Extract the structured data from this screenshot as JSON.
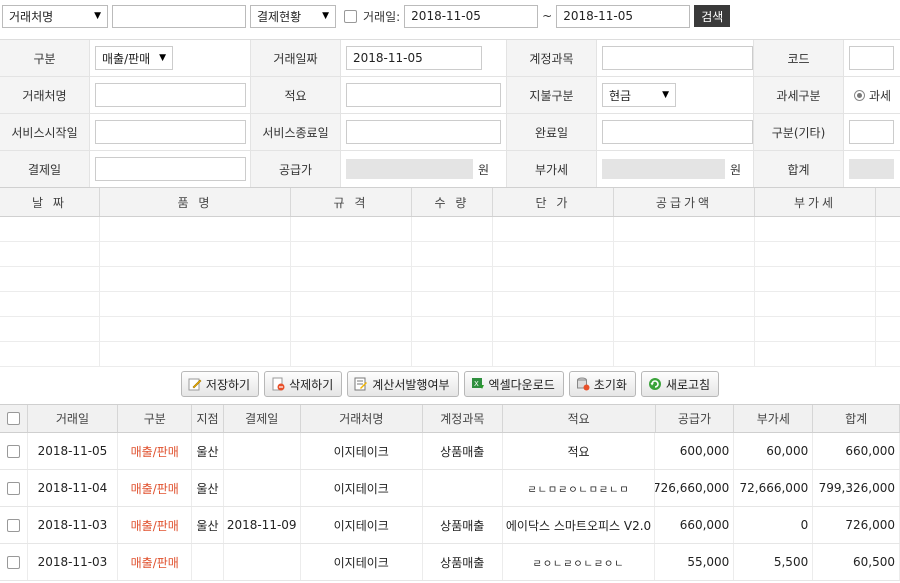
{
  "search": {
    "partner_select": "거래처명",
    "partner_input": "",
    "status_select": "결제현황",
    "date_checkbox_label": "거래일:",
    "date_from": "2018-11-05",
    "tilde": "~",
    "date_to": "2018-11-05",
    "search_button": "검색"
  },
  "form": {
    "row1": {
      "type_label": "구분",
      "type_value": "매출/판매",
      "date_label": "거래일짜",
      "date_value": "2018-11-05",
      "account_label": "계정과목",
      "account_value": "",
      "code_label": "코드",
      "code_value": ""
    },
    "row2": {
      "partner_label": "거래처명",
      "partner_value": "",
      "memo_label": "적요",
      "memo_value": "",
      "payment_label": "지불구분",
      "payment_value": "현금",
      "tax_label": "과세구분",
      "tax_value": "과세"
    },
    "row3": {
      "start_label": "서비스시작일",
      "start_value": "",
      "end_label": "서비스종료일",
      "end_value": "",
      "complete_label": "완료일",
      "complete_value": "",
      "etc_label": "구분(기타)",
      "etc_value": ""
    },
    "row4": {
      "settle_label": "결제일",
      "settle_value": "",
      "supply_label": "공급가",
      "supply_unit": "원",
      "vat_label": "부가세",
      "vat_unit": "원",
      "total_label": "합계"
    }
  },
  "items": {
    "headers": [
      "날 짜",
      "품 명",
      "규 격",
      "수 량",
      "단 가",
      "공급가액",
      "부가세"
    ]
  },
  "actions": {
    "save": "저장하기",
    "delete": "삭제하기",
    "invoice": "계산서발행여부",
    "excel": "엑셀다운로드",
    "reset": "초기화",
    "refresh": "새로고침"
  },
  "list": {
    "headers": [
      "거래일",
      "구분",
      "지점",
      "결제일",
      "거래처명",
      "계정과목",
      "적요",
      "공급가",
      "부가세",
      "합계"
    ],
    "rows": [
      {
        "date": "2018-11-05",
        "type": "매출/판매",
        "branch": "울산",
        "settle": "",
        "partner": "이지테이크",
        "account": "상품매출",
        "memo": "적요",
        "supply": "600,000",
        "vat": "60,000",
        "total": "660,000"
      },
      {
        "date": "2018-11-04",
        "type": "매출/판매",
        "branch": "울산",
        "settle": "",
        "partner": "이지테이크",
        "account": "",
        "memo": "ㄹㄴㅁㄹㅇㄴㅁㄹㄴㅁ",
        "supply": "726,660,000",
        "vat": "72,666,000",
        "total": "799,326,000"
      },
      {
        "date": "2018-11-03",
        "type": "매출/판매",
        "branch": "울산",
        "settle": "2018-11-09",
        "partner": "이지테이크",
        "account": "상품매출",
        "memo": "에이닥스 스마트오피스 V2.0",
        "supply": "660,000",
        "vat": "0",
        "total": "726,000"
      },
      {
        "date": "2018-11-03",
        "type": "매출/판매",
        "branch": "",
        "settle": "",
        "partner": "이지테이크",
        "account": "상품매출",
        "memo": "ㄹㅇㄴㄹㅇㄴㄹㅇㄴ",
        "supply": "55,000",
        "vat": "5,500",
        "total": "60,500"
      }
    ]
  }
}
